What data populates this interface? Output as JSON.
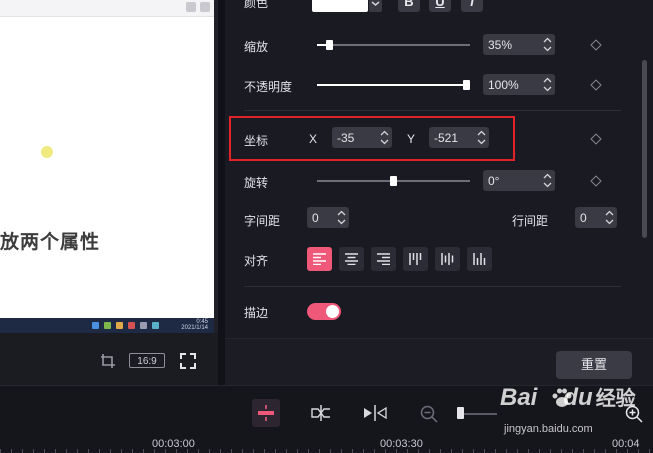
{
  "preview": {
    "overlay_text": "放两个属性",
    "aspect_ratio": "16:9",
    "taskbar_time": "0:45",
    "taskbar_date": "2021/1/14"
  },
  "panel": {
    "color_label": "颜色",
    "format_buttons": [
      "B",
      "U",
      "I"
    ],
    "scale": {
      "label": "缩放",
      "value": "35%",
      "level": 0.06
    },
    "opacity": {
      "label": "不透明度",
      "value": "100%",
      "level": 1.0
    },
    "position": {
      "label": "坐标",
      "x_label": "X",
      "x_value": "-35",
      "y_label": "Y",
      "y_value": "-521"
    },
    "rotation": {
      "label": "旋转",
      "value": "0°",
      "level": 0.5
    },
    "letter_spacing": {
      "label": "字间距",
      "value": "0"
    },
    "line_spacing": {
      "label": "行间距",
      "value": "0"
    },
    "align": {
      "label": "对齐",
      "options": [
        "align-left",
        "align-center",
        "align-right",
        "align-top",
        "align-middle",
        "align-bottom"
      ],
      "selected": "align-left"
    },
    "stroke": {
      "label": "描边",
      "enabled": true
    },
    "reset_label": "重置"
  },
  "timeline": {
    "time_labels": [
      "00:03:00",
      "00:03:30",
      "00:04"
    ]
  },
  "watermark": {
    "logo_text_a": "Bai",
    "logo_text_b": "du",
    "logo_text_c": "经验",
    "url": "jingyan.baidu.com"
  },
  "colors": {
    "accent": "#f0587a",
    "highlight_box": "#e2232a",
    "panel_bg": "#1a1a22"
  }
}
